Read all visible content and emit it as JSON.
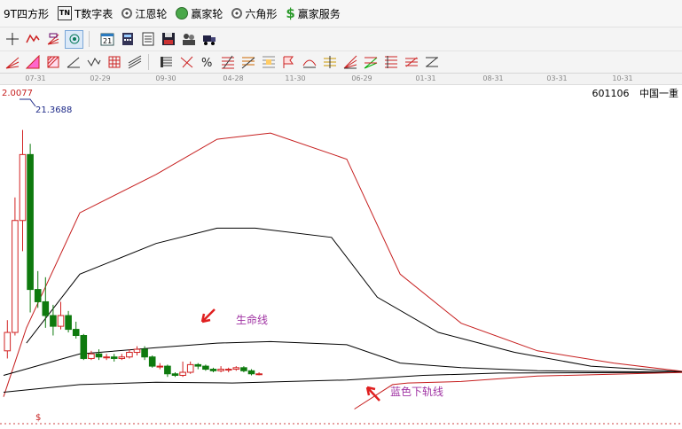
{
  "menubar": {
    "items": [
      {
        "key": "square",
        "label": "9T四方形",
        "icon": "none"
      },
      {
        "key": "tn",
        "label": "T数字表",
        "icon": "tn-badge-icon"
      },
      {
        "key": "jiangen",
        "label": "江恩轮",
        "icon": "ring-icon"
      },
      {
        "key": "yingjia",
        "label": "赢家轮",
        "icon": "green-wheel-icon"
      },
      {
        "key": "hex",
        "label": "六角形",
        "icon": "ring-icon"
      },
      {
        "key": "service",
        "label": "赢家服务",
        "icon": "dollar-icon"
      }
    ]
  },
  "date_axis": {
    "labels": [
      "07-31",
      "02-29",
      "09-30",
      "04-28",
      "11-30",
      "06-29",
      "01-31",
      "08-31",
      "03-31",
      "10-31"
    ]
  },
  "chart": {
    "stock_code": "601106",
    "stock_name": "中国一重",
    "high_label": "2.0077",
    "peak_label": "21.3688",
    "label_life_line": "生命线",
    "label_blue_lower": "蓝色下轨线",
    "dollar_marker": "$",
    "colors": {
      "up": "#d22222",
      "down": "#0e7a0e",
      "red_band": "#c61e1e",
      "black_band": "#000000",
      "purple_text": "#a033a3"
    }
  },
  "chart_data": {
    "type": "line",
    "note": "candlestick price chart with envelope band lines; values in chart price units (approximate)",
    "candles": [
      {
        "open": 7.0,
        "close": 8.2,
        "high": 9.0,
        "low": 6.5
      },
      {
        "open": 8.2,
        "close": 15.5,
        "high": 17.0,
        "low": 8.0
      },
      {
        "open": 15.5,
        "close": 19.8,
        "high": 21.4,
        "low": 13.5
      },
      {
        "open": 19.8,
        "close": 11.0,
        "high": 20.5,
        "low": 9.5
      },
      {
        "open": 11.0,
        "close": 10.2,
        "high": 12.2,
        "low": 9.8
      },
      {
        "open": 10.2,
        "close": 9.3,
        "high": 11.8,
        "low": 8.5
      },
      {
        "open": 9.3,
        "close": 8.6,
        "high": 10.0,
        "low": 8.0
      },
      {
        "open": 8.6,
        "close": 9.3,
        "high": 10.2,
        "low": 8.4
      },
      {
        "open": 9.3,
        "close": 8.4,
        "high": 9.6,
        "low": 8.2
      },
      {
        "open": 8.4,
        "close": 8.0,
        "high": 8.9,
        "low": 7.8
      },
      {
        "open": 8.0,
        "close": 6.5,
        "high": 8.1,
        "low": 6.4
      },
      {
        "open": 6.5,
        "close": 6.8,
        "high": 7.0,
        "low": 6.4
      },
      {
        "open": 6.8,
        "close": 6.6,
        "high": 7.1,
        "low": 6.4
      },
      {
        "open": 6.6,
        "close": 6.6,
        "high": 6.8,
        "low": 6.4
      },
      {
        "open": 6.6,
        "close": 6.5,
        "high": 6.8,
        "low": 6.3
      },
      {
        "open": 6.5,
        "close": 6.6,
        "high": 6.8,
        "low": 6.4
      },
      {
        "open": 6.6,
        "close": 6.9,
        "high": 7.1,
        "low": 6.5
      },
      {
        "open": 6.9,
        "close": 7.1,
        "high": 7.3,
        "low": 6.7
      },
      {
        "open": 7.1,
        "close": 6.6,
        "high": 7.3,
        "low": 6.4
      },
      {
        "open": 6.6,
        "close": 6.0,
        "high": 6.7,
        "low": 5.9
      },
      {
        "open": 6.0,
        "close": 6.0,
        "high": 6.2,
        "low": 5.8
      },
      {
        "open": 6.0,
        "close": 5.5,
        "high": 6.1,
        "low": 5.3
      },
      {
        "open": 5.5,
        "close": 5.4,
        "high": 5.6,
        "low": 5.3
      },
      {
        "open": 5.4,
        "close": 5.6,
        "high": 6.3,
        "low": 5.3
      },
      {
        "open": 5.6,
        "close": 6.1,
        "high": 6.3,
        "low": 5.5
      },
      {
        "open": 6.1,
        "close": 6.0,
        "high": 6.2,
        "low": 5.8
      },
      {
        "open": 6.0,
        "close": 5.8,
        "high": 6.1,
        "low": 5.7
      },
      {
        "open": 5.8,
        "close": 5.7,
        "high": 5.9,
        "low": 5.6
      },
      {
        "open": 5.7,
        "close": 5.8,
        "high": 6.0,
        "low": 5.6
      },
      {
        "open": 5.8,
        "close": 5.8,
        "high": 5.9,
        "low": 5.6
      },
      {
        "open": 5.8,
        "close": 5.9,
        "high": 6.0,
        "low": 5.7
      },
      {
        "open": 5.9,
        "close": 5.7,
        "high": 6.0,
        "low": 5.6
      },
      {
        "open": 5.7,
        "close": 5.5,
        "high": 5.8,
        "low": 5.4
      },
      {
        "open": 5.5,
        "close": 5.5,
        "high": 5.6,
        "low": 5.4
      }
    ],
    "series": [
      {
        "color": "#c61e1e",
        "points": [
          [
            0,
            4.0
          ],
          [
            3,
            8.5
          ],
          [
            10,
            16.0
          ],
          [
            20,
            18.5
          ],
          [
            28,
            20.8
          ],
          [
            35,
            21.2
          ],
          [
            45,
            19.5
          ],
          [
            52,
            12.0
          ],
          [
            60,
            8.8
          ],
          [
            70,
            7.0
          ],
          [
            80,
            6.2
          ],
          [
            90,
            5.6
          ]
        ]
      },
      {
        "color": "#000000",
        "points": [
          [
            3,
            7.5
          ],
          [
            10,
            12.0
          ],
          [
            20,
            14.0
          ],
          [
            28,
            15.0
          ],
          [
            33,
            15.0
          ],
          [
            43,
            14.4
          ],
          [
            49,
            10.5
          ],
          [
            57,
            8.2
          ],
          [
            67,
            6.9
          ],
          [
            77,
            6.0
          ],
          [
            90,
            5.6
          ]
        ]
      },
      {
        "color": "#000000",
        "points": [
          [
            0,
            5.4
          ],
          [
            10,
            6.8
          ],
          [
            20,
            7.2
          ],
          [
            28,
            7.5
          ],
          [
            35,
            7.6
          ],
          [
            45,
            7.4
          ],
          [
            52,
            6.2
          ],
          [
            60,
            5.9
          ],
          [
            70,
            5.7
          ],
          [
            90,
            5.6
          ]
        ]
      },
      {
        "color": "#000000",
        "points": [
          [
            0,
            4.3
          ],
          [
            10,
            4.8
          ],
          [
            20,
            4.95
          ],
          [
            30,
            4.9
          ],
          [
            45,
            5.1
          ],
          [
            55,
            5.4
          ],
          [
            65,
            5.55
          ],
          [
            90,
            5.6
          ]
        ]
      },
      {
        "color": "#c61e1e",
        "points": [
          [
            46,
            3.2
          ],
          [
            51,
            4.8
          ],
          [
            53,
            4.9
          ],
          [
            60,
            5.0
          ],
          [
            70,
            5.35
          ],
          [
            90,
            5.6
          ]
        ]
      }
    ],
    "ylim": [
      3.0,
      23.0
    ],
    "price_annotations": [
      "2.0077",
      "21.3688"
    ]
  }
}
